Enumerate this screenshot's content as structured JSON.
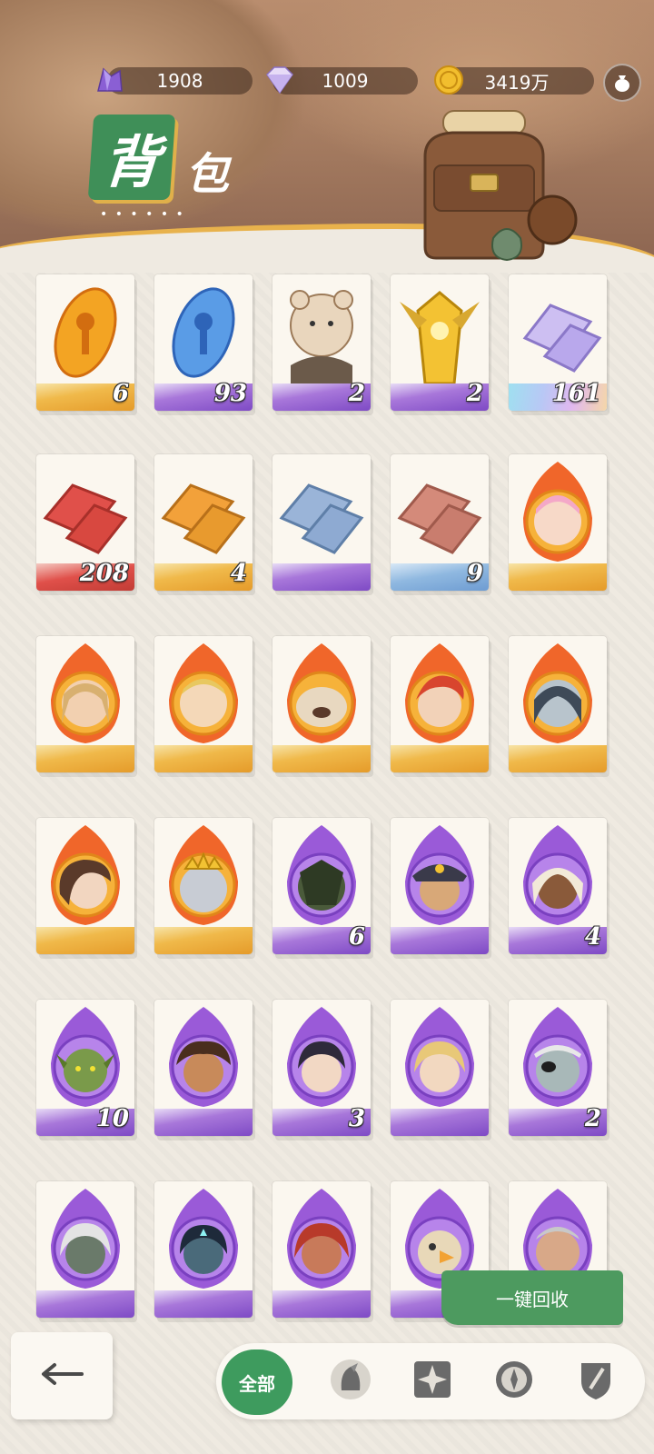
{
  "header": {
    "title_first_char": "背",
    "title_rest": "包",
    "title_dots": "• • • • • •",
    "currencies": [
      {
        "icon": "purple-crystal-icon",
        "value": "1908"
      },
      {
        "icon": "diamond-icon",
        "value": "1009"
      },
      {
        "icon": "gold-coin-icon",
        "value": "3419万"
      }
    ],
    "money_bag_icon": "money-bag-icon"
  },
  "items": [
    {
      "kind": "gold-key-gem",
      "rarity": "gold",
      "count": "6"
    },
    {
      "kind": "blue-key-gem",
      "rarity": "purple",
      "count": "93"
    },
    {
      "kind": "hamster-figure",
      "rarity": "purple",
      "count": "2"
    },
    {
      "kind": "golden-helmet",
      "rarity": "purple",
      "count": "2"
    },
    {
      "kind": "lavender-ingot",
      "rarity": "rainbow",
      "count": "161"
    },
    {
      "kind": "red-ingot",
      "rarity": "red",
      "count": "208"
    },
    {
      "kind": "orange-ingot",
      "rarity": "gold",
      "count": "4"
    },
    {
      "kind": "blue-ingot",
      "rarity": "purple",
      "count": ""
    },
    {
      "kind": "pink-ingot",
      "rarity": "blue",
      "count": "9"
    },
    {
      "kind": "hero-pink-hair",
      "rarity": "gold",
      "count": ""
    },
    {
      "kind": "hero-long-blond",
      "rarity": "gold",
      "count": ""
    },
    {
      "kind": "hero-elf",
      "rarity": "gold",
      "count": ""
    },
    {
      "kind": "hero-bear",
      "rarity": "gold",
      "count": ""
    },
    {
      "kind": "hero-red-hair",
      "rarity": "gold",
      "count": ""
    },
    {
      "kind": "hero-pale",
      "rarity": "gold",
      "count": ""
    },
    {
      "kind": "hero-brunette",
      "rarity": "gold",
      "count": ""
    },
    {
      "kind": "hero-crowned-beast",
      "rarity": "gold",
      "count": ""
    },
    {
      "kind": "hero-dark-armor",
      "rarity": "purple",
      "count": "6"
    },
    {
      "kind": "hero-captain",
      "rarity": "purple",
      "count": ""
    },
    {
      "kind": "hero-white-hair",
      "rarity": "purple",
      "count": "4"
    },
    {
      "kind": "hero-goblin",
      "rarity": "purple",
      "count": "10"
    },
    {
      "kind": "hero-curly-hair",
      "rarity": "purple",
      "count": ""
    },
    {
      "kind": "hero-girl",
      "rarity": "purple",
      "count": "3"
    },
    {
      "kind": "hero-blond-woman",
      "rarity": "purple",
      "count": ""
    },
    {
      "kind": "hero-eyepatch",
      "rarity": "purple",
      "count": "2"
    },
    {
      "kind": "hero-silver-hair",
      "rarity": "purple",
      "count": ""
    },
    {
      "kind": "hero-demon",
      "rarity": "purple",
      "count": ""
    },
    {
      "kind": "hero-red-curls",
      "rarity": "purple",
      "count": ""
    },
    {
      "kind": "hero-bird",
      "rarity": "purple",
      "count": ""
    },
    {
      "kind": "hero-old-man",
      "rarity": "purple",
      "count": ""
    }
  ],
  "actions": {
    "recycle_label": "一键回收",
    "back_icon": "back-arrow-icon"
  },
  "tabs": {
    "all_label": "全部",
    "filters": [
      "warrior-helmet-icon",
      "star-compass-icon",
      "compass-icon",
      "shield-sword-icon"
    ]
  },
  "colors": {
    "accent_green": "#3e9b5e",
    "gold": "#e8b24c",
    "purple": "#8a52d0"
  }
}
